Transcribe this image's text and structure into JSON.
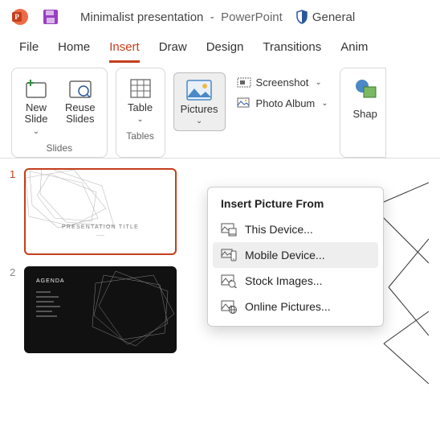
{
  "titlebar": {
    "doc_name": "Minimalist presentation",
    "separator": "-",
    "app_name": "PowerPoint",
    "sensitivity": "General"
  },
  "tabs": {
    "file": "File",
    "home": "Home",
    "insert": "Insert",
    "draw": "Draw",
    "design": "Design",
    "transitions": "Transitions",
    "anim": "Anim"
  },
  "ribbon": {
    "slides_group": "Slides",
    "tables_group": "Tables",
    "new_slide": "New\nSlide",
    "reuse_slides": "Reuse\nSlides",
    "table": "Table",
    "pictures": "Pictures",
    "screenshot": "Screenshot",
    "photo_album": "Photo Album",
    "shapes": "Shap"
  },
  "dropdown": {
    "header": "Insert Picture From",
    "this_device": "This Device...",
    "mobile_device": "Mobile Device...",
    "stock_images": "Stock Images...",
    "online_pictures": "Online Pictures..."
  },
  "thumbs": {
    "n1": "1",
    "n2": "2",
    "slide1_title": "PRESENTATION TITLE",
    "slide1_sub": "——",
    "slide2_title": "AGENDA"
  }
}
